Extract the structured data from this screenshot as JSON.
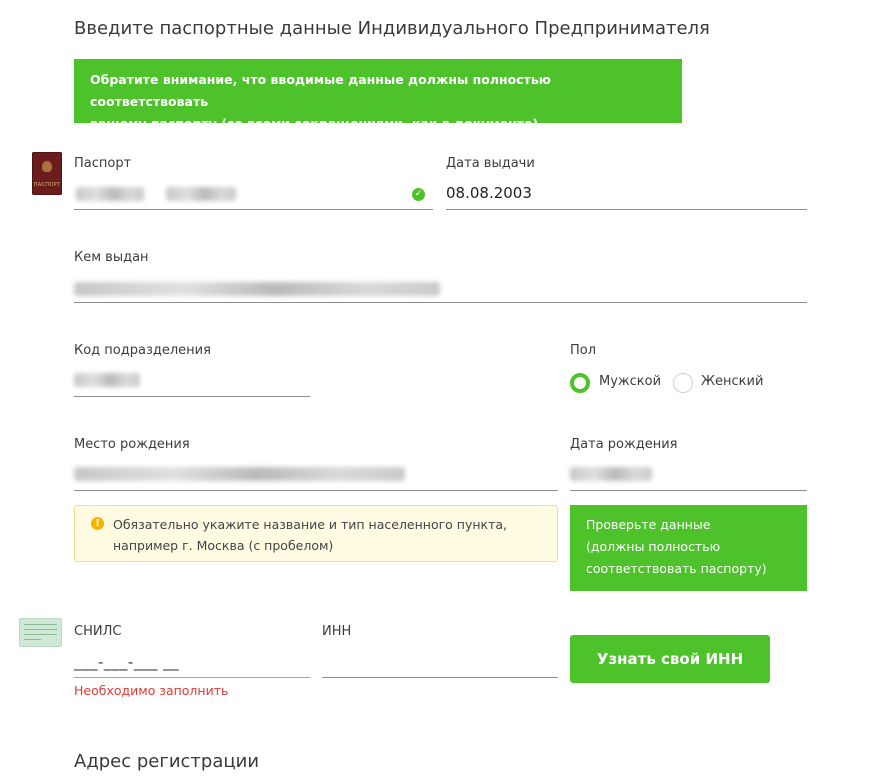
{
  "header": {
    "title": "Введите паспортные данные Индивидуального Предпринимателя"
  },
  "notice": {
    "line1": "Обратите внимание, что вводимые данные должны полностью соответствовать",
    "line2": "вашему паспорту (со всеми сокращениями, как в документе)"
  },
  "passport": {
    "label": "Паспорт",
    "icon": "passport-icon",
    "icon_text": "ПАСПОРТ",
    "status_icon": "check-circle-icon"
  },
  "issue_date": {
    "label": "Дата выдачи",
    "value": "08.08.2003"
  },
  "issued_by": {
    "label": "Кем выдан"
  },
  "division_code": {
    "label": "Код подразделения"
  },
  "gender": {
    "label": "Пол",
    "options": [
      {
        "label": "Мужской",
        "selected": true
      },
      {
        "label": "Женский",
        "selected": false
      }
    ]
  },
  "birth_place": {
    "label": "Место рождения"
  },
  "birth_date": {
    "label": "Дата рождения"
  },
  "warning": {
    "icon": "exclamation-circle-icon",
    "line1": "Обязательно укажите название и тип населенного пункта,",
    "line2": "например г. Москва (с пробелом)"
  },
  "verify": {
    "line1": "Проверьте данные",
    "line2": "(должны полностью",
    "line3": "соответствовать паспорту)"
  },
  "snils": {
    "label": "СНИЛС",
    "mask": "___-___-___ __",
    "error": "Необходимо заполнить",
    "icon": "snils-card-icon"
  },
  "inn": {
    "label": "ИНН",
    "value": ""
  },
  "inn_button": {
    "label": "Узнать свой ИНН"
  },
  "address_section": {
    "title": "Адрес регистрации"
  },
  "colors": {
    "accent": "#4ec22a",
    "error": "#e53935",
    "warning_bg": "#fffbe2",
    "warning_icon": "#f4b400"
  }
}
